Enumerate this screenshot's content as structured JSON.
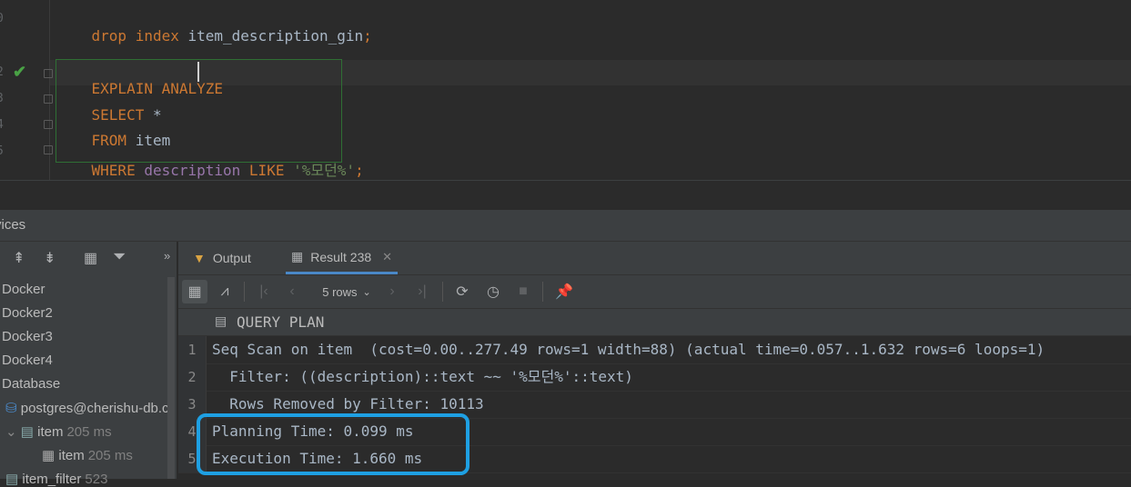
{
  "editor": {
    "lines": [
      {
        "num": "0",
        "tokens": [
          {
            "t": "drop ",
            "c": "kw"
          },
          {
            "t": "index ",
            "c": "kw"
          },
          {
            "t": "item_description_gin",
            "c": "id"
          },
          {
            "t": ";",
            "c": "kw"
          }
        ]
      },
      {
        "num": "2",
        "tokens": [
          {
            "t": "EXPLAIN ",
            "c": "kw"
          },
          {
            "t": "ANALYZE",
            "c": "kw"
          }
        ]
      },
      {
        "num": "3",
        "tokens": [
          {
            "t": "SELECT ",
            "c": "kw"
          },
          {
            "t": "*",
            "c": "id"
          }
        ]
      },
      {
        "num": "4",
        "tokens": [
          {
            "t": "FROM ",
            "c": "kw"
          },
          {
            "t": "item",
            "c": "id"
          }
        ]
      },
      {
        "num": "5",
        "tokens": [
          {
            "t": "WHERE ",
            "c": "kw"
          },
          {
            "t": "description ",
            "c": "col"
          },
          {
            "t": "LIKE ",
            "c": "kw"
          },
          {
            "t": "'%모던%'",
            "c": "str"
          },
          {
            "t": ";",
            "c": "kw"
          }
        ]
      }
    ]
  },
  "services": {
    "title": "vices",
    "tree": [
      {
        "label": "Docker"
      },
      {
        "label": "Docker2"
      },
      {
        "label": "Docker3"
      },
      {
        "label": "Docker4"
      },
      {
        "label": "Database"
      },
      {
        "label": "postgres@cherishu-db.c"
      },
      {
        "label": "item",
        "meta": "205 ms"
      },
      {
        "label": "item",
        "meta": "205 ms"
      },
      {
        "label": "item_filter",
        "meta": "523"
      }
    ]
  },
  "tabs": [
    {
      "label": "Output"
    },
    {
      "label": "Result 238",
      "close": "✕"
    }
  ],
  "toolbar": {
    "rows_label": "5 rows"
  },
  "grid": {
    "header": "QUERY PLAN",
    "rows": [
      {
        "num": "1",
        "text": "Seq Scan on item  (cost=0.00..277.49 rows=1 width=88) (actual time=0.057..1.632 rows=6 loops=1)"
      },
      {
        "num": "2",
        "text": "  Filter: ((description)::text ~~ '%모던%'::text)"
      },
      {
        "num": "3",
        "text": "  Rows Removed by Filter: 10113"
      },
      {
        "num": "4",
        "text": "Planning Time: 0.099 ms"
      },
      {
        "num": "5",
        "text": "Execution Time: 1.660 ms"
      }
    ]
  },
  "colors": {
    "keyword": "#cc7832",
    "column": "#9876aa",
    "string": "#6a8759",
    "highlight": "#1ea0e3",
    "check": "#49a245"
  }
}
